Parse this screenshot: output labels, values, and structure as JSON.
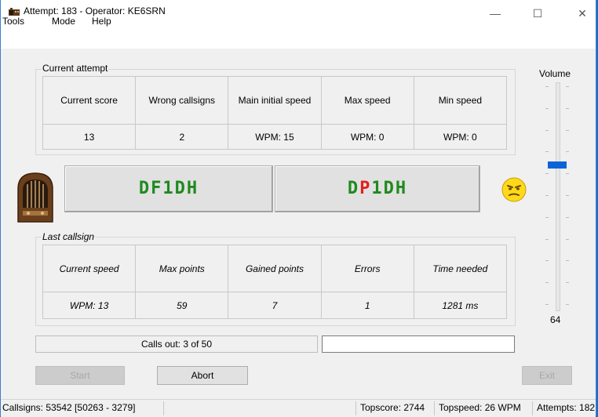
{
  "window": {
    "title": "Attempt: 183 - Operator: KE6SRN",
    "minimize_glyph": "—",
    "maximize_glyph": "☐",
    "close_glyph": "✕"
  },
  "menu": {
    "tools": "Tools",
    "mode": "Mode",
    "help": "Help"
  },
  "current_attempt": {
    "legend": "Current attempt",
    "headers": [
      "Current score",
      "Wrong callsigns",
      "Main initial speed",
      "Max speed",
      "Min speed"
    ],
    "values": [
      "13",
      "2",
      "WPM: 15",
      "WPM: 0",
      "WPM: 0"
    ]
  },
  "callsigns": {
    "sent": "DF1DH",
    "received_prefix": "D",
    "received_error": "P",
    "received_suffix": "1DH",
    "color_ok": "#1e8a1e",
    "color_error": "#e02020"
  },
  "last_callsign": {
    "legend": "Last callsign",
    "headers": [
      "Current speed",
      "Max points",
      "Gained points",
      "Errors",
      "Time needed"
    ],
    "values": [
      "WPM: 13",
      "59",
      "7",
      "1",
      "1281 ms"
    ]
  },
  "volume": {
    "label": "Volume",
    "value": "64",
    "level_fraction": 0.64,
    "accent": "#0a64d8"
  },
  "progress": {
    "calls_out": "Calls out: 3 of 50",
    "entry_value": ""
  },
  "buttons": {
    "start": "Start",
    "abort": "Abort",
    "exit": "Exit"
  },
  "statusbar": {
    "callsigns": "Callsigns: 53542 [50263 - 3279]",
    "topscore": "Topscore: 2744",
    "topspeed": "Topspeed: 26 WPM",
    "attempts": "Attempts: 182"
  },
  "icons": {
    "app": "radio-app-icon",
    "radio": "vintage-radio-icon",
    "mood": "frowning-face-icon"
  }
}
